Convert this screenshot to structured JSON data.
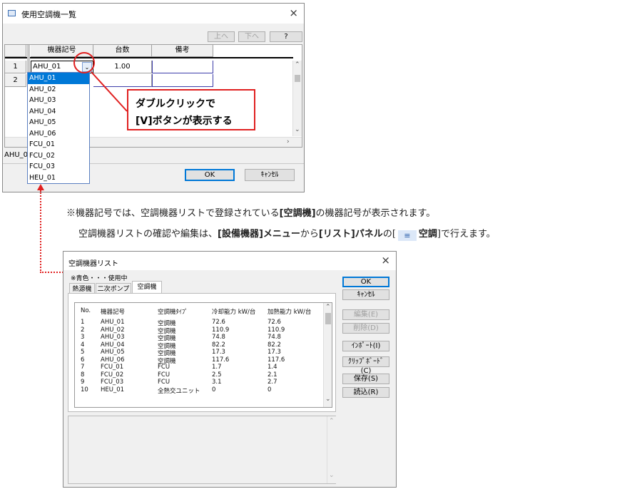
{
  "top_dialog": {
    "title": "使用空調機一覧",
    "close": "×",
    "buttons": {
      "up": "上へ",
      "down": "下へ",
      "help": "?",
      "ok": "OK",
      "cancel": "ｷｬﾝｾﾙ"
    },
    "columns": [
      "機器記号",
      "台数",
      "備考"
    ],
    "rows": [
      {
        "num": "1",
        "code": "AHU_01",
        "count": "1.00",
        "note": ""
      },
      {
        "num": "2",
        "code": "",
        "count": "",
        "note": ""
      }
    ],
    "dropdown_items": [
      "AHU_01",
      "AHU_02",
      "AHU_03",
      "AHU_04",
      "AHU_05",
      "AHU_06",
      "FCU_01",
      "FCU_02",
      "FCU_03",
      "HEU_01"
    ],
    "status_text": "AHU_0",
    "callout": {
      "line1": "ダブルクリックで",
      "line2": "[V]ボタンが表示する"
    }
  },
  "note": {
    "line1_a": "※機器記号では、空調機器リストで登録されている",
    "line1_b": "[空調機]",
    "line1_c": "の機器記号が表示されます。",
    "line2_a": "空調機器リストの確認や編集は、",
    "line2_b": "[設備機器]メニュー",
    "line2_c": "から",
    "line2_d": "[リスト]パネル",
    "line2_e": "の[",
    "line2_f": "空調",
    "line2_g": "]で行えます。"
  },
  "list_dialog": {
    "title": "空調機器リスト",
    "close": "×",
    "legend": "※青色・・・使用中",
    "tabs": [
      "熱源機",
      "二次ポンプ",
      "空調機"
    ],
    "active_tab": 2,
    "headers": [
      "No.",
      "機器記号",
      "空調機ﾀｲﾌﾟ",
      "冷却能力 kW/台",
      "加熱能力 kW/台"
    ],
    "rows": [
      [
        "1",
        "AHU_01",
        "空調機",
        "72.6",
        "72.6"
      ],
      [
        "2",
        "AHU_02",
        "空調機",
        "110.9",
        "110.9"
      ],
      [
        "3",
        "AHU_03",
        "空調機",
        "74.8",
        "74.8"
      ],
      [
        "4",
        "AHU_04",
        "空調機",
        "82.2",
        "82.2"
      ],
      [
        "5",
        "AHU_05",
        "空調機",
        "17.3",
        "17.3"
      ],
      [
        "6",
        "AHU_06",
        "空調機",
        "117.6",
        "117.6"
      ],
      [
        "7",
        "FCU_01",
        "FCU",
        "1.7",
        "1.4"
      ],
      [
        "8",
        "FCU_02",
        "FCU",
        "2.5",
        "2.1"
      ],
      [
        "9",
        "FCU_03",
        "FCU",
        "3.1",
        "2.7"
      ],
      [
        "10",
        "HEU_01",
        "全熱交ユニット",
        "0",
        "0"
      ]
    ],
    "buttons": {
      "ok": "OK",
      "cancel": "ｷｬﾝｾﾙ",
      "edit": "編集(E)",
      "delete": "削除(D)",
      "import": "ｲﾝﾎﾟｰﾄ(I)",
      "clipboard": "ｸﾘｯﾌﾟﾎﾞｰﾄﾞ(C)",
      "save": "保存(S)",
      "load": "読込(R)"
    }
  }
}
